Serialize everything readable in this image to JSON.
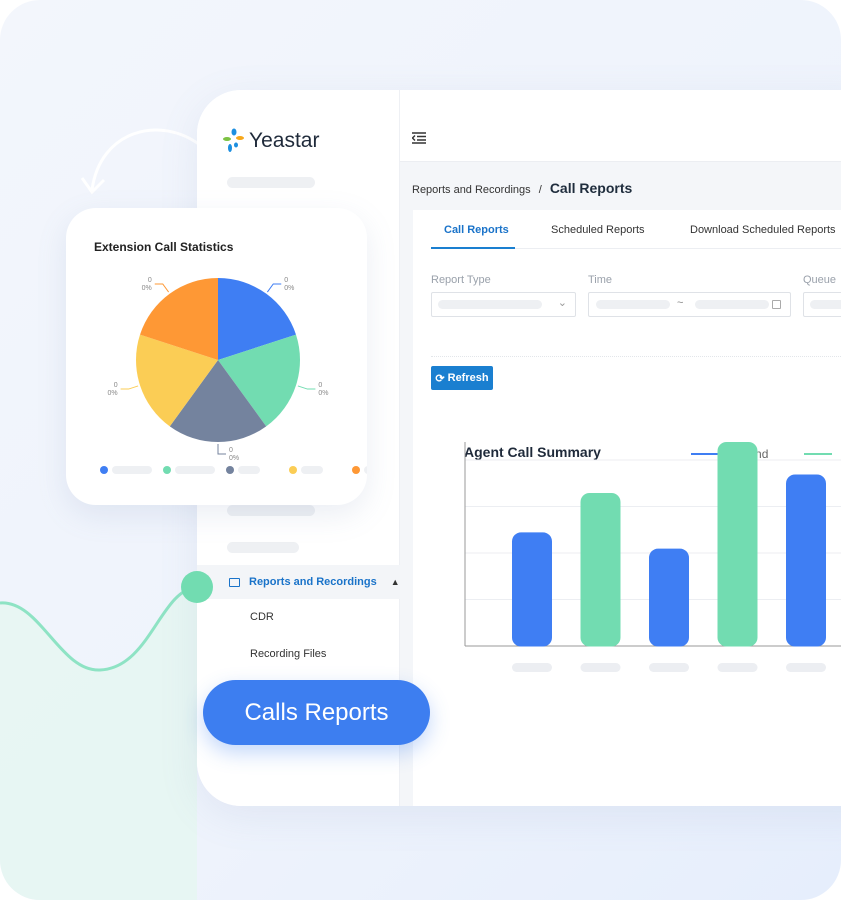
{
  "brand": {
    "name": "Yeastar"
  },
  "sidebar": {
    "active_item": "Reports and Recordings",
    "sub_items": [
      "CDR",
      "Recording Files"
    ]
  },
  "breadcrumb": {
    "parent": "Reports and Recordings",
    "separator": "/",
    "current": "Call Reports"
  },
  "tabs": [
    {
      "label": "Call Reports",
      "active": true
    },
    {
      "label": "Scheduled Reports"
    },
    {
      "label": "Download Scheduled Reports"
    }
  ],
  "filters": {
    "report_type": "Report Type",
    "time": "Time",
    "time_separator": "~",
    "queue": "Queue"
  },
  "buttons": {
    "refresh": "Refresh"
  },
  "pill": {
    "label": "Calls Reports"
  },
  "colors": {
    "blue": "#3f7ef3",
    "green": "#72dcb1",
    "gray": "#74839e",
    "yellow": "#fbcd55",
    "orange": "#fe9835",
    "accent": "#1a7fd0"
  },
  "chart_data": [
    {
      "type": "pie",
      "title": "Extension Call Statistics",
      "slices": [
        {
          "value": 0,
          "label": "0",
          "percent": "0%",
          "color": "#3f7ef3"
        },
        {
          "value": 0,
          "label": "0",
          "percent": "0%",
          "color": "#72dcb1"
        },
        {
          "value": 0,
          "label": "0",
          "percent": "0%",
          "color": "#74839e"
        },
        {
          "value": 0,
          "label": "0",
          "percent": "0%",
          "color": "#fbcd55"
        },
        {
          "value": 0,
          "label": "0",
          "percent": "0%",
          "color": "#fe9835"
        }
      ]
    },
    {
      "type": "bar",
      "title": "Agent Call Summary",
      "legend": [
        {
          "name": "Inbound",
          "color": "#3f7ef3"
        },
        {
          "name": "",
          "color": "#72dcb1"
        }
      ],
      "values": [
        2.45,
        3.3,
        2.1,
        4.4,
        3.7
      ],
      "colors": [
        "#3f7ef3",
        "#72dcb1",
        "#3f7ef3",
        "#72dcb1",
        "#3f7ef3"
      ],
      "ylim": [
        0,
        4.4
      ],
      "grid": true
    }
  ]
}
